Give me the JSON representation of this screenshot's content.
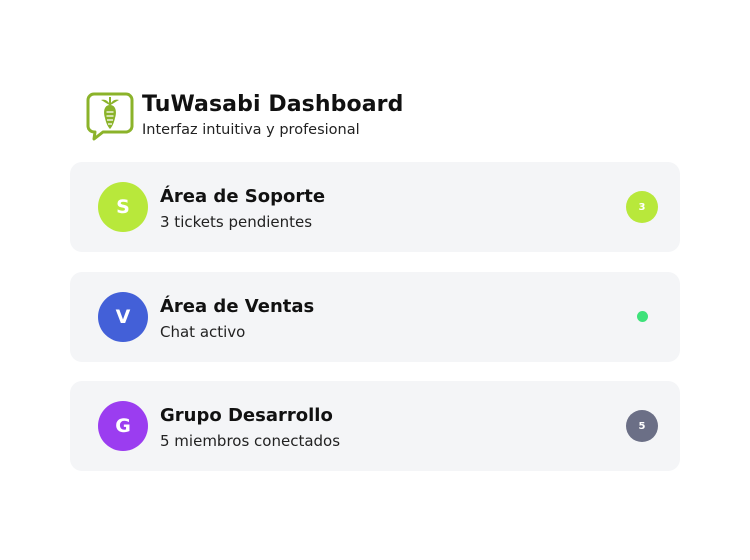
{
  "header": {
    "title": "TuWasabi Dashboard",
    "subtitle": "Interfaz intuitiva y profesional",
    "logo_icon": "wasabi-chat-bubble-icon",
    "logo_color": "#8bb32a"
  },
  "chats": [
    {
      "avatar_letter": "S",
      "avatar_color": "#b8e83b",
      "title": "Área de Soporte",
      "subtitle": "3 tickets pendientes",
      "badge": "3",
      "badge_color": "#b8e83b"
    },
    {
      "avatar_letter": "V",
      "avatar_color": "#4360d8",
      "title": "Área de Ventas",
      "subtitle": "Chat activo",
      "status": "online",
      "status_color": "#3ee27a"
    },
    {
      "avatar_letter": "G",
      "avatar_color": "#9b3df0",
      "title": "Grupo Desarrollo",
      "subtitle": "5 miembros conectados",
      "badge": "5",
      "badge_color": "#6b6f86"
    }
  ]
}
